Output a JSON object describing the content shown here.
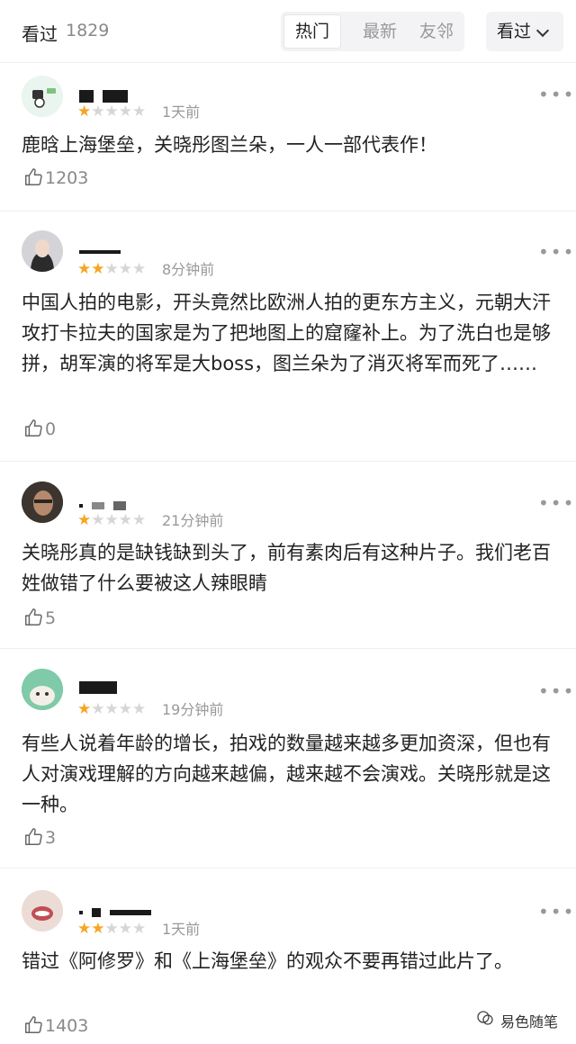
{
  "header": {
    "seen_label": "看过",
    "seen_count": "1829",
    "tabs": [
      {
        "label": "热门",
        "active": true
      },
      {
        "label": "最新",
        "active": false
      },
      {
        "label": "友邻",
        "active": false
      }
    ],
    "filter_label": "看过"
  },
  "reviews": [
    {
      "stars": 1,
      "time": "1天前",
      "text": "鹿晗上海堡垒，关晓彤图兰朵，一人一部代表作！",
      "likes": "1203"
    },
    {
      "stars": 2,
      "time": "8分钟前",
      "text": "中国人拍的电影，开头竟然比欧洲人拍的更东方主义，元朝大汗攻打卡拉夫的国家是为了把地图上的窟窿补上。为了洗白也是够拼，胡军演的将军是大boss，图兰朵为了消灭将军而死了……",
      "likes": "0"
    },
    {
      "stars": 1,
      "time": "21分钟前",
      "text": "关晓彤真的是缺钱缺到头了，前有素肉后有这种片子。我们老百姓做错了什么要被这人辣眼睛",
      "likes": "5"
    },
    {
      "stars": 1,
      "time": "19分钟前",
      "text": "有些人说着年龄的增长，拍戏的数量越来越多更加资深，但也有人对演戏理解的方向越来越偏，越来越不会演戏。关晓彤就是这一种。",
      "likes": "3"
    },
    {
      "stars": 2,
      "time": "1天前",
      "text": "错过《阿修罗》和《上海堡垒》的观众不要再错过此片了。",
      "likes": "1403"
    }
  ],
  "watermark": "易色随笔",
  "colors": {
    "star_on": "#f5a623",
    "star_off": "#d6d6d6",
    "muted": "#999999"
  }
}
